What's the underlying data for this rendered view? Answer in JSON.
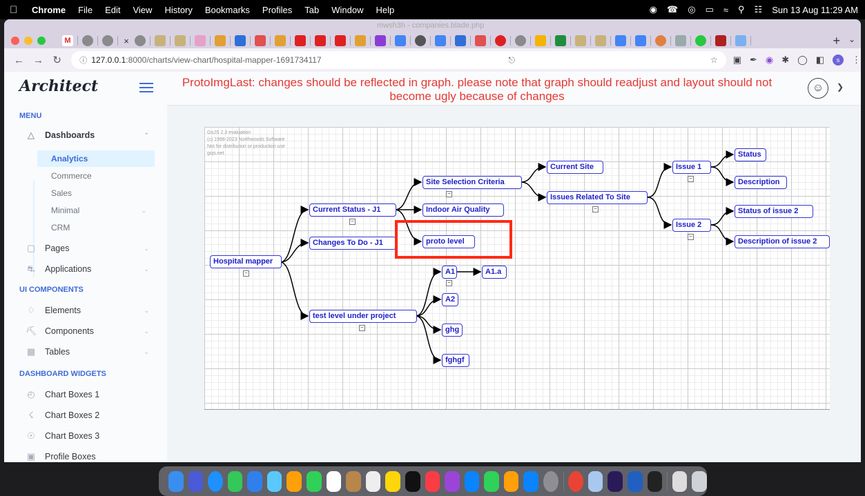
{
  "menubar": {
    "app": "Chrome",
    "items": [
      "File",
      "Edit",
      "View",
      "History",
      "Bookmarks",
      "Profiles",
      "Tab",
      "Window",
      "Help"
    ],
    "datetime": "Sun 13 Aug  11:29 AM"
  },
  "browser": {
    "tab_title": "mwsh3h - companies.blade.php",
    "url_host": "127.0.0.1",
    "url_rest": ":8000/charts/view-chart/hospital-mapper-1691734117",
    "profile_initial": "s"
  },
  "header": {
    "logo": "Architect",
    "notice": "ProtoImgLast: changes should be reflected in graph. please note that graph should readjust and layout should not become ugly because of changes"
  },
  "sidebar": {
    "menu_label": "MENU",
    "dashboards": "Dashboards",
    "dashboard_items": [
      "Analytics",
      "Commerce",
      "Sales",
      "Minimal",
      "CRM"
    ],
    "pages": "Pages",
    "applications": "Applications",
    "ui_label": "UI COMPONENTS",
    "elements": "Elements",
    "components": "Components",
    "tables": "Tables",
    "widgets_label": "DASHBOARD WIDGETS",
    "chart_boxes_1": "Chart Boxes 1",
    "chart_boxes_2": "Chart Boxes 2",
    "chart_boxes_3": "Chart Boxes 3",
    "profile_boxes": "Profile Boxes"
  },
  "diagram": {
    "watermark": [
      "GoJS 2.3 evaluation",
      "(c) 1998-2023 Northwoods Software",
      "Not for distribution or production use",
      "gojs.net"
    ],
    "nodes": {
      "root": "Hospital mapper",
      "current_status": "Current Status - J1",
      "changes_to_do": "Changes To Do - J1",
      "test_level": "test level under project",
      "site_selection": "Site Selection Criteria",
      "indoor_air": "Indoor Air Quality",
      "proto_level": "proto level",
      "current_site": "Current Site",
      "issues_related": "Issues Related To Site",
      "issue_1": "Issue 1",
      "issue_2": "Issue 2",
      "status": "Status",
      "description": "Description",
      "status_issue_2": "Status of issue 2",
      "description_issue_2": "Description of issue 2",
      "a1": "A1",
      "a1a": "A1.a",
      "a2": "A2",
      "ghg": "ghg",
      "fghgf": "fghgf"
    },
    "collapse_symbol": "−"
  },
  "colors": {
    "accent": "#3f6ad8",
    "node_text": "#1f21c9",
    "notice": "#e53935",
    "highlight": "#ff2a14"
  }
}
